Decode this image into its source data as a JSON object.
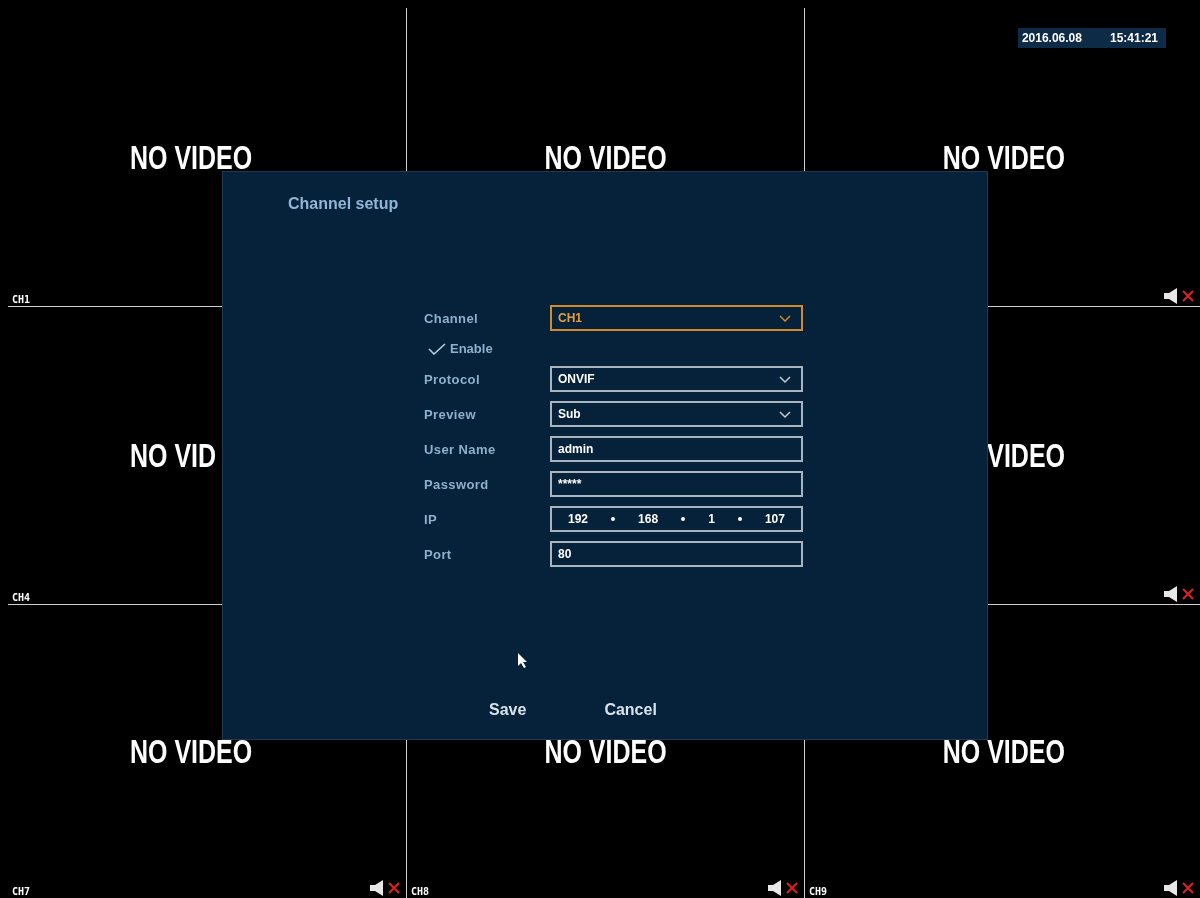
{
  "tiles": [
    {
      "no_video": "NO VIDEO",
      "channel": "CH1"
    },
    {
      "no_video": "NO VIDEO"
    },
    {
      "no_video": "NO VIDEO",
      "muted": true,
      "date": "2016.06.08",
      "time": "15:41:21"
    },
    {
      "no_video": "NO VID",
      "channel": "CH4"
    },
    {
      "no_video": "VIDEO",
      "muted": true
    },
    {
      "no_video": "NO VIDEO",
      "channel": "CH7",
      "muted": true
    },
    {
      "no_video": "NO VIDEO",
      "channel": "CH8",
      "muted": true
    },
    {
      "no_video": "NO VIDEO",
      "channel": "CH9",
      "muted": true
    }
  ],
  "dialog": {
    "title": "Channel setup",
    "rows": [
      {
        "kind": "select",
        "label": "Channel",
        "value": "CH1",
        "focused": true
      },
      {
        "kind": "checkbox",
        "label": "Enable",
        "checked": true
      },
      {
        "kind": "select",
        "label": "Protocol",
        "value": "ONVIF",
        "focused": false
      },
      {
        "kind": "select",
        "label": "Preview",
        "value": "Sub",
        "focused": false
      },
      {
        "kind": "text",
        "label": "User Name",
        "value": "admin"
      },
      {
        "kind": "text",
        "label": "Password",
        "value": "*****"
      },
      {
        "kind": "ip",
        "label": "IP",
        "octets": [
          "192",
          "168",
          "1",
          "107"
        ]
      },
      {
        "kind": "text",
        "label": "Port",
        "value": "80"
      }
    ],
    "buttons": [
      "Save",
      "Cancel"
    ]
  }
}
